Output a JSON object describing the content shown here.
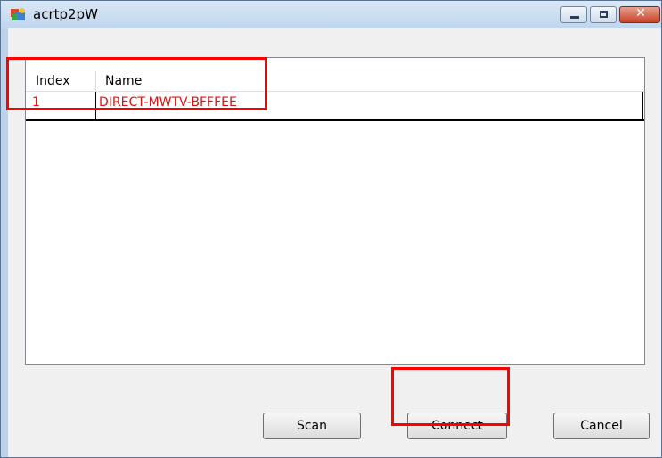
{
  "window": {
    "title": "acrtp2pW"
  },
  "controls": {
    "minimize_icon": "minimize-icon",
    "maximize_icon": "maximize-icon",
    "close_icon": "close-icon",
    "close_glyph": "✕"
  },
  "list": {
    "columns": [
      "Index",
      "Name"
    ],
    "rows": [
      {
        "index": "1",
        "name": "DIRECT-MWTV-BFFFEE"
      }
    ]
  },
  "buttons": {
    "scan": "Scan",
    "connect": "Connect",
    "cancel": "Cancel"
  },
  "colors": {
    "selected_row_text": "#e80f0f",
    "highlight_box": "#ff0000"
  }
}
